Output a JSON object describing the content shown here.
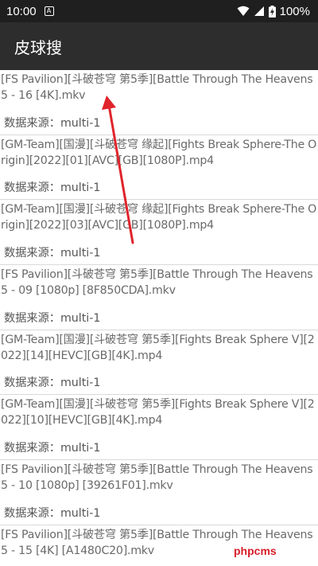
{
  "status_bar": {
    "time": "10:00",
    "notification_icon": "A",
    "battery_text": "100%"
  },
  "app_bar": {
    "title": "皮球搜"
  },
  "results": [
    {
      "title": "[FS Pavilion][斗破苍穹 第5季][Battle Through The Heavens 5 - 16 [4K].mkv",
      "source": "数据来源：multi-1"
    },
    {
      "title": "[GM-Team][国漫][斗破苍穹 缘起][Fights Break Sphere-The Origin][2022][01][AVC][GB][1080P].mp4",
      "source": "数据来源：multi-1"
    },
    {
      "title": "[GM-Team][国漫][斗破苍穹 缘起][Fights Break Sphere-The Origin][2022][03][AVC][GB][1080P].mp4",
      "source": "数据来源：multi-1"
    },
    {
      "title": "[FS Pavilion][斗破苍穹 第5季][Battle Through The Heavens 5 - 09 [1080p] [8F850CDA].mkv",
      "source": "数据来源：multi-1"
    },
    {
      "title": "[GM-Team][国漫][斗破苍穹 第5季][Fights Break Sphere V][2022][14][HEVC][GB][4K].mp4",
      "source": "数据来源：multi-1"
    },
    {
      "title": "[GM-Team][国漫][斗破苍穹 第5季][Fights Break Sphere V][2022][10][HEVC][GB][4K].mp4",
      "source": "数据来源：multi-1"
    },
    {
      "title": "[FS Pavilion][斗破苍穹 第5季][Battle Through The Heavens 5 - 10 [1080p] [39261F01].mkv",
      "source": "数据来源：multi-1"
    },
    {
      "title": "[FS Pavilion][斗破苍穹 第5季][Battle Through The Heavens 5 - 15 [4K] [A1480C20].mkv",
      "source": ""
    }
  ],
  "watermark": "phpcms",
  "colors": {
    "status_bar": "#1f1f1f",
    "app_bar": "#2d2d2d",
    "annotation_arrow": "#e0242b",
    "divider": "#d9d9d9"
  }
}
